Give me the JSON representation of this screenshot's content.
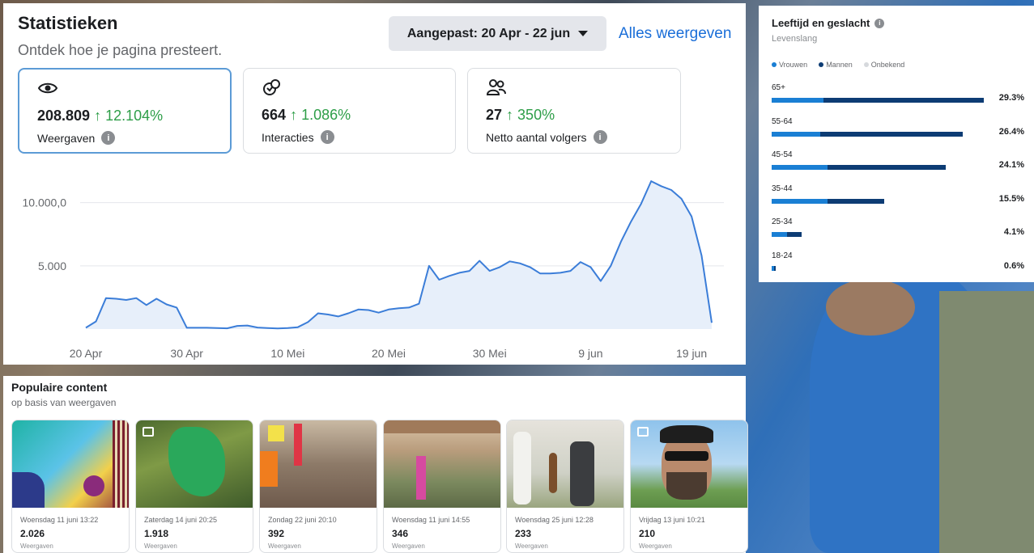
{
  "stats": {
    "title": "Statistieken",
    "subtitle": "Ontdek hoe je pagina presteert.",
    "date_range": "Aangepast: 20 Apr - 22 jun",
    "view_all": "Alles weergeven",
    "metrics": [
      {
        "value": "208.809",
        "change": "↑ 12.104%",
        "label": "Weergaven",
        "icon": "eye-icon",
        "active": true
      },
      {
        "value": "664",
        "change": "↑ 1.086%",
        "label": "Interacties",
        "icon": "interactions-icon",
        "active": false
      },
      {
        "value": "27",
        "change": "↑ 350%",
        "label": "Netto aantal volgers",
        "icon": "followers-icon",
        "active": false
      }
    ]
  },
  "chart_data": {
    "type": "area",
    "title": "",
    "xlabel": "",
    "ylabel": "",
    "y_ticks": [
      {
        "value": 5000,
        "label": "5.000"
      },
      {
        "value": 10000,
        "label": "10.000,0"
      }
    ],
    "ylim": [
      0,
      11000
    ],
    "x_ticks": [
      "20 Apr",
      "30 Apr",
      "10 Mei",
      "20 Mei",
      "30 Mei",
      "9 jun",
      "19 jun"
    ],
    "x_start": "2025-04-20",
    "grid": true,
    "color": "#3b7dd8",
    "fill": "#e7effa",
    "series": [
      {
        "values": [
          100,
          600,
          2450,
          2400,
          2300,
          2450,
          1900,
          2400,
          1950,
          1700,
          100,
          100,
          100,
          80,
          60,
          250,
          280,
          120,
          80,
          50,
          80,
          150,
          550,
          1250,
          1150,
          1000,
          1250,
          1550,
          1500,
          1300,
          1550,
          1650,
          1700,
          2000,
          5000,
          3900,
          4200,
          4450,
          4600,
          5400,
          4600,
          4900,
          5350,
          5200,
          4900,
          4400,
          4400,
          4450,
          4600,
          5300,
          4900,
          3800,
          5000,
          6900,
          8500,
          9900,
          11700,
          11300,
          11000,
          10300,
          8900,
          5800,
          500
        ]
      }
    ]
  },
  "demo": {
    "title": "Leeftijd en geslacht",
    "subtitle": "Levenslang",
    "legend": [
      {
        "label": "Vrouwen",
        "color": "#1a7fd4"
      },
      {
        "label": "Mannen",
        "color": "#0d3c74"
      },
      {
        "label": "Onbekend",
        "color": "#d6d9dd"
      }
    ],
    "ages": [
      {
        "range": "65+",
        "pct": "29.3%",
        "women": 7.2,
        "men": 22.1
      },
      {
        "range": "55-64",
        "pct": "26.4%",
        "women": 6.7,
        "men": 19.7
      },
      {
        "range": "45-54",
        "pct": "24.1%",
        "women": 7.7,
        "men": 16.4
      },
      {
        "range": "35-44",
        "pct": "15.5%",
        "women": 7.7,
        "men": 7.8
      },
      {
        "range": "25-34",
        "pct": "4.1%",
        "women": 2.1,
        "men": 2.0
      },
      {
        "range": "18-24",
        "pct": "0.6%",
        "women": 0.3,
        "men": 0.3
      }
    ]
  },
  "popular": {
    "title": "Populaire content",
    "subtitle": "op basis van weergaven",
    "posts": [
      {
        "date": "Woensdag 11 juni 13:22",
        "views": "2.026",
        "label": "Weergaven"
      },
      {
        "date": "Zaterdag 14 juni 20:25",
        "views": "1.918",
        "label": "Weergaven"
      },
      {
        "date": "Zondag 22 juni 20:10",
        "views": "392",
        "label": "Weergaven"
      },
      {
        "date": "Woensdag 11 juni 14:55",
        "views": "346",
        "label": "Weergaven"
      },
      {
        "date": "Woensdag 25 juni 12:28",
        "views": "233",
        "label": "Weergaven"
      },
      {
        "date": "Vrijdag 13 juni 10:21",
        "views": "210",
        "label": "Weergaven"
      }
    ]
  }
}
